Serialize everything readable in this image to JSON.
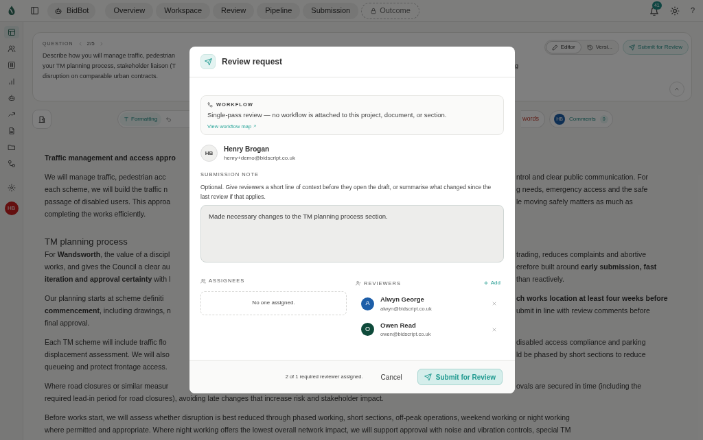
{
  "topbar": {
    "workspace": "BidBot",
    "nav": [
      {
        "label": "Overview",
        "locked": false
      },
      {
        "label": "Workspace",
        "locked": false
      },
      {
        "label": "Review",
        "locked": false
      },
      {
        "label": "Pipeline",
        "locked": false
      },
      {
        "label": "Submission",
        "locked": false
      },
      {
        "label": "Outcome",
        "locked": true
      }
    ],
    "notifications": "41",
    "help": "?"
  },
  "sidebar": {
    "items": [
      {
        "selected": true
      },
      {
        "selected": false
      },
      {
        "selected": false
      },
      {
        "selected": false
      },
      {
        "selected": false
      },
      {
        "selected": false
      },
      {
        "selected": false
      },
      {
        "selected": false
      },
      {
        "selected": false
      }
    ],
    "avatar": "HB"
  },
  "question": {
    "label": "QUESTION",
    "pager": "2/5",
    "lines": [
      "Describe how you will manage traffic, pedestrian",
      "your TM planning process, stakeholder liaison (T",
      "disruption on comparable urban contracts."
    ],
    "fragment": "g",
    "views": [
      {
        "label": "Editor",
        "selected": true
      },
      {
        "label": "Versi...",
        "selected": false
      }
    ],
    "submit": "Submit for Review"
  },
  "editor_toolbar": {
    "formatting": "Formatting",
    "words": "words",
    "comments_avatar": "HB",
    "comments": "Comments",
    "comments_count": "0"
  },
  "document": {
    "blocks": [
      {
        "kind": "title",
        "lines": [
          {
            "left": "Traffic management and access appro"
          }
        ]
      },
      {
        "kind": "para",
        "lines": [
          {
            "left": "We will manage traffic, pedestrian acc",
            "right": "ntrol and clear public communication. For"
          },
          {
            "left": "each scheme, we will build the traffic n",
            "right": "g needs, emergency access and the safe"
          },
          {
            "left": "passage of disabled users. This approa",
            "right": "le moving safely matters as much as"
          },
          {
            "left": "completing the works efficiently."
          }
        ]
      },
      {
        "kind": "heading",
        "lines": [
          {
            "left": "TM planning process"
          }
        ]
      },
      {
        "kind": "para",
        "lines": [
          {
            "left": "For **Wandsworth**, the value of a discipl",
            "right": "trading, reduces complaints and abortive"
          },
          {
            "left": "works, and gives the Council a clear au",
            "right": "erefore built around **early submission, fast**"
          },
          {
            "left": "**iteration and approval certainty** with l",
            "right": "than reactively."
          }
        ]
      },
      {
        "kind": "para",
        "lines": [
          {
            "left": "Our planning starts at scheme definiti",
            "right": "**ch works location at least four weeks before**"
          },
          {
            "left": "**commencement**, including drawings, n",
            "right": "ubmit in line with review comments before"
          },
          {
            "left": "final approval."
          }
        ]
      },
      {
        "kind": "para",
        "lines": [
          {
            "left": "Each TM scheme will include traffic flo",
            "right": "disabled access compliance and parking"
          },
          {
            "left": "displacement assessment. We will also",
            "right": "ld be phased by short sections to reduce"
          },
          {
            "left": "queueing and protect frontage access."
          }
        ]
      },
      {
        "kind": "para",
        "lines": [
          {
            "left": "Where road closures or similar measur",
            "right": "ovals are secured in time (including the"
          },
          {
            "text": "required lead-in period for road closures), avoiding late changes that increase risk and stakeholder impact."
          }
        ]
      },
      {
        "kind": "para",
        "lines": [
          {
            "text": "Before works start, we will assess whether disruption is best reduced through phased working, short sections, off-peak operations, weekend working or night working"
          },
          {
            "text": "where permitted and appropriate. Where night working offers the lowest overall network impact, we will support approval with noise and vibration controls, special TM"
          }
        ]
      }
    ]
  },
  "dialog": {
    "title": "Review request",
    "workflow": {
      "label": "WORKFLOW",
      "text": "Single-pass review — no workflow is attached to this project, document, or section.",
      "link": "View workflow map"
    },
    "requester": {
      "initials": "HB",
      "name": "Henry Brogan",
      "email": "henry+demo@bidscript.co.uk"
    },
    "note": {
      "label": "SUBMISSION NOTE",
      "help": "Optional. Give reviewers a short line of context before they open the draft, or summarise what changed since the last review if that applies.",
      "value": "Made necessary changes to the TM planning process section."
    },
    "assignees": {
      "label": "ASSIGNEES",
      "empty": "No one assigned."
    },
    "reviewers": {
      "label": "REVIEWERS",
      "add": "Add",
      "items": [
        {
          "initial": "A",
          "name": "Alwyn George",
          "email": "alwyn@bidscript.co.uk",
          "color": "#1d5ea8"
        },
        {
          "initial": "O",
          "name": "Owen Read",
          "email": "owen@bidscript.co.uk",
          "color": "#0e4a3a"
        }
      ]
    },
    "footer": {
      "status": "2 of 1 required reviewer assigned.",
      "cancel": "Cancel",
      "submit": "Submit for Review"
    }
  }
}
